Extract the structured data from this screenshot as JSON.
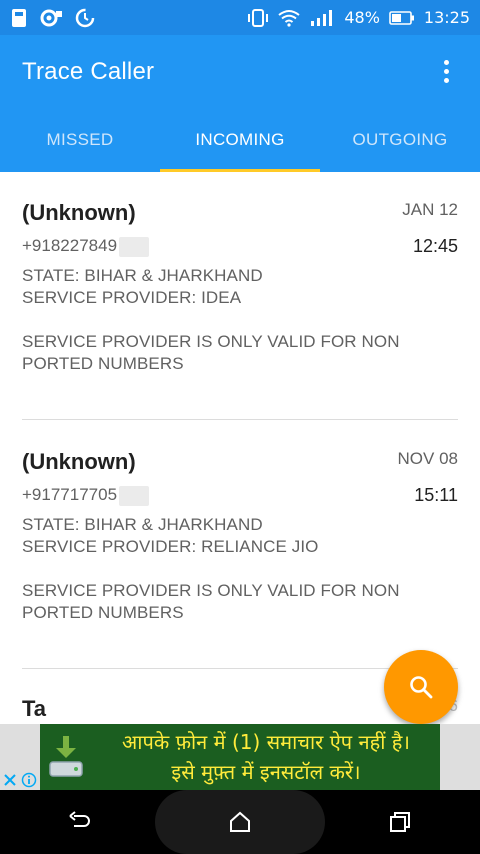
{
  "status_bar": {
    "battery_percent": "48%",
    "time": "13:25",
    "icons": [
      "image-icon",
      "notification-icon",
      "sync-icon",
      "vibrate-icon",
      "wifi-icon",
      "signal-icon",
      "battery-icon"
    ]
  },
  "app_bar": {
    "title": "Trace Caller",
    "menu_icon": "overflow-menu-icon"
  },
  "tabs": [
    {
      "label": "MISSED",
      "active": false
    },
    {
      "label": "INCOMING",
      "active": true
    },
    {
      "label": "OUTGOING",
      "active": false
    }
  ],
  "calls": [
    {
      "caller": "(Unknown)",
      "number": "+918227849",
      "date": "JAN 12",
      "time": "12:45",
      "state": "STATE: BIHAR & JHARKHAND",
      "provider": "SERVICE PROVIDER: IDEA",
      "note_line1": "SERVICE PROVIDER IS ONLY VALID FOR NON",
      "note_line2": "PORTED NUMBERS"
    },
    {
      "caller": "(Unknown)",
      "number": "+917717705",
      "date": "NOV 08",
      "time": "15:11",
      "state": "STATE: BIHAR & JHARKHAND",
      "provider": "SERVICE PROVIDER: RELIANCE JIO",
      "note_line1": "SERVICE PROVIDER IS ONLY VALID FOR NON",
      "note_line2": "PORTED NUMBERS"
    },
    {
      "caller": "Ta",
      "date": "6"
    }
  ],
  "fab": {
    "icon": "search-icon"
  },
  "ad": {
    "line1": "आपके फ़ोन में (1) समाचार ऐप नहीं है।",
    "line2": "इसे मुफ़्त में इनसटॉल करें।",
    "icon": "download-drive-icon",
    "close_icon": "close-icon",
    "info_icon": "info-icon"
  },
  "nav_bar": {
    "icons": [
      "back-icon",
      "home-icon",
      "recents-icon"
    ]
  },
  "colors": {
    "status_bar": "#1e88e5",
    "app_bar": "#2196f3",
    "tab_indicator": "#ffca28",
    "fab": "#ff9800",
    "ad_background": "#1b5e20",
    "ad_text": "#ffeb3b"
  }
}
